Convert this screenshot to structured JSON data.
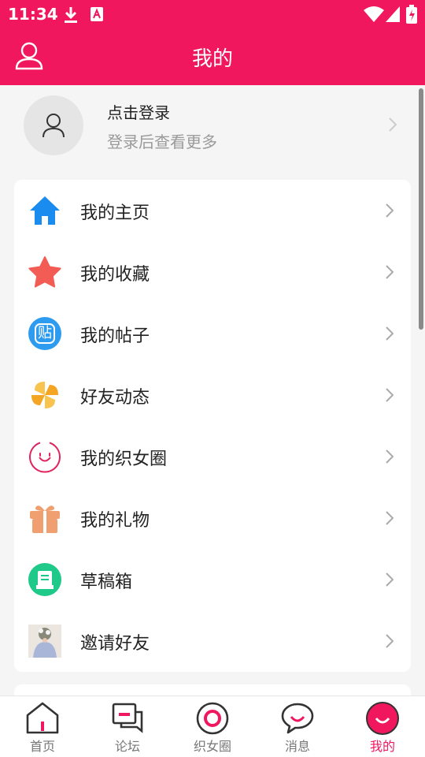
{
  "status_bar": {
    "time": "11:34"
  },
  "header": {
    "title": "我的"
  },
  "login": {
    "title": "点击登录",
    "subtitle": "登录后查看更多"
  },
  "menu": [
    {
      "label": "我的主页",
      "icon": "home-icon"
    },
    {
      "label": "我的收藏",
      "icon": "star-icon"
    },
    {
      "label": "我的帖子",
      "icon": "post-icon",
      "badge": "贴"
    },
    {
      "label": "好友动态",
      "icon": "pinwheel-icon"
    },
    {
      "label": "我的织女圈",
      "icon": "circle-icon"
    },
    {
      "label": "我的礼物",
      "icon": "gift-icon"
    },
    {
      "label": "草稿箱",
      "icon": "draft-icon"
    },
    {
      "label": "邀请好友",
      "icon": "invite-photo"
    }
  ],
  "tabs": [
    {
      "label": "首页",
      "icon": "home-tab-icon",
      "active": false
    },
    {
      "label": "论坛",
      "icon": "forum-tab-icon",
      "active": false
    },
    {
      "label": "织女圈",
      "icon": "circle-tab-icon",
      "active": false
    },
    {
      "label": "消息",
      "icon": "message-tab-icon",
      "active": false
    },
    {
      "label": "我的",
      "icon": "profile-tab-icon",
      "active": true
    }
  ],
  "colors": {
    "primary": "#f0175f",
    "background": "#f5f5f5",
    "card": "#ffffff"
  }
}
